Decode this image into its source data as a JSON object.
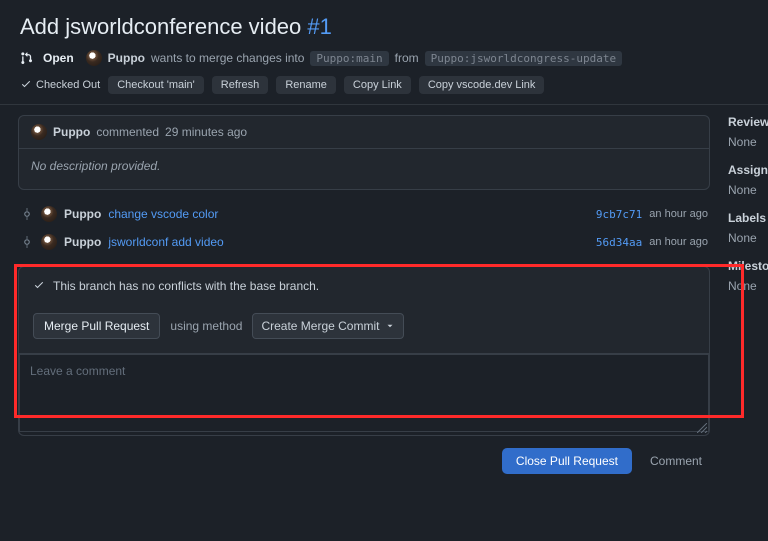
{
  "pr": {
    "title": "Add jsworldconference video",
    "number": "#1",
    "state": "Open",
    "author": "Puppo",
    "merge_text_1": "wants to merge changes into",
    "base_branch": "Puppo:main",
    "merge_text_2": "from",
    "head_branch": "Puppo:jsworldcongress-update"
  },
  "actions": {
    "checked_out": "Checked Out",
    "checkout": "Checkout 'main'",
    "refresh": "Refresh",
    "rename": "Rename",
    "copy_link": "Copy Link",
    "copy_vscode": "Copy vscode.dev Link"
  },
  "comment": {
    "author": "Puppo",
    "verb": "commented",
    "time": "29 minutes ago",
    "body": "No description provided."
  },
  "commits": [
    {
      "author": "Puppo",
      "msg": "change vscode color",
      "sha": "9cb7c71",
      "time": "an hour ago"
    },
    {
      "author": "Puppo",
      "msg": "jsworldconf add video",
      "sha": "56d34aa",
      "time": "an hour ago"
    }
  ],
  "merge": {
    "status": "This branch has no conflicts with the base branch.",
    "button": "Merge Pull Request",
    "method_label": "using method",
    "method_value": "Create Merge Commit"
  },
  "new_comment": {
    "placeholder": "Leave a comment"
  },
  "footer": {
    "close": "Close Pull Request",
    "comment": "Comment"
  },
  "sidebar": {
    "reviewers_h": "Reviewers",
    "reviewers_v": "None",
    "assignees_h": "Assignees",
    "assignees_v": "None",
    "labels_h": "Labels",
    "labels_v": "None",
    "milestone_h": "Milestone",
    "milestone_v": "None"
  }
}
